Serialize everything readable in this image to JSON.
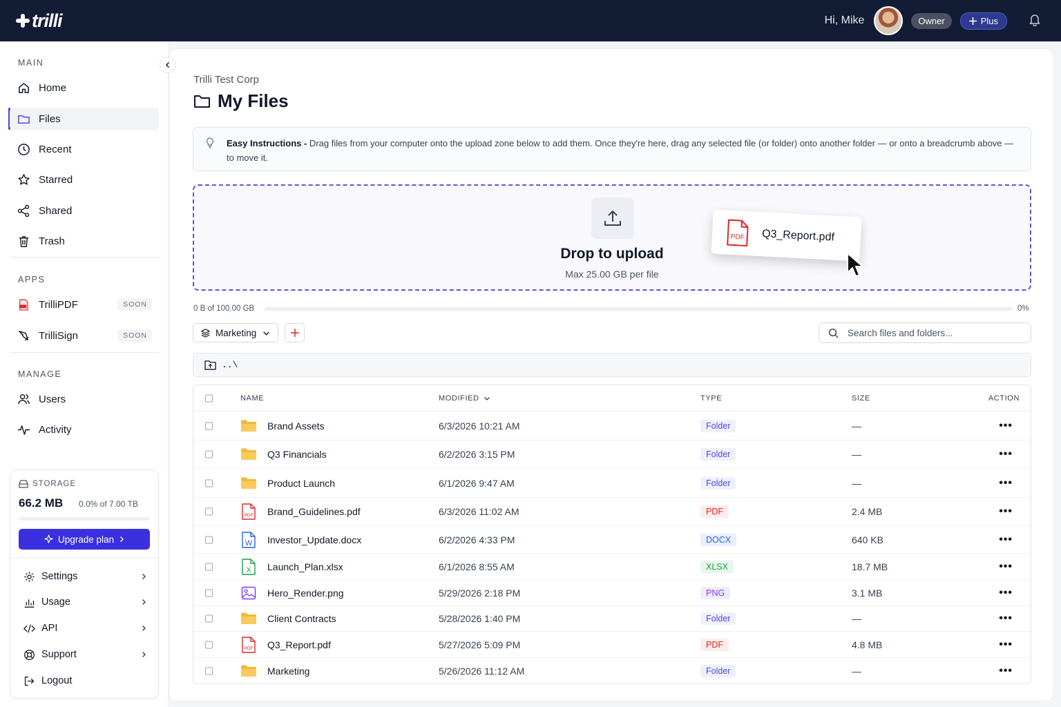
{
  "app": {
    "logo_text": "trilli",
    "greeting": "Hi, Mike",
    "role_badge": "Owner",
    "plan_badge": "Plus"
  },
  "sidebar": {
    "main_label": "MAIN",
    "main_items": [
      {
        "label": "Home",
        "icon": "home-icon"
      },
      {
        "label": "Files",
        "icon": "folder-icon",
        "active": true
      },
      {
        "label": "Recent",
        "icon": "clock-icon"
      },
      {
        "label": "Starred",
        "icon": "star-icon"
      },
      {
        "label": "Shared",
        "icon": "share-icon"
      },
      {
        "label": "Trash",
        "icon": "trash-icon"
      }
    ],
    "apps_label": "APPS",
    "apps_items": [
      {
        "label": "TrilliPDF",
        "badge": "SOON",
        "icon": "pdf-app-icon"
      },
      {
        "label": "TrilliSign",
        "badge": "SOON",
        "icon": "signature-icon"
      }
    ],
    "manage_label": "MANAGE",
    "manage_items": [
      {
        "label": "Users",
        "icon": "users-icon"
      },
      {
        "label": "Activity",
        "icon": "activity-icon"
      }
    ],
    "storage": {
      "label": "STORAGE",
      "used": "66.2 MB",
      "percent_text": "0.0% of 7.00 TB",
      "percent": 0.0,
      "upgrade_label": "Upgrade plan"
    },
    "bottom_items": [
      {
        "label": "Settings",
        "icon": "gear-icon"
      },
      {
        "label": "Usage",
        "icon": "bar-chart-icon"
      },
      {
        "label": "API",
        "icon": "code-icon"
      },
      {
        "label": "Support",
        "icon": "lifebuoy-icon"
      },
      {
        "label": "Logout",
        "icon": "logout-icon"
      }
    ]
  },
  "main": {
    "org_name": "Trilli Test Corp",
    "title": "My Files",
    "instructions_bold": "Easy Instructions -",
    "instructions_text": " Drag files from your computer onto the upload zone below to add them. Once they're here, drag any selected file (or folder) onto another folder — or onto a breadcrumb above — to move it.",
    "dropzone": {
      "title": "Drop to upload",
      "subtitle": "Max 25.00 GB per file",
      "dragging_file": "Q3_Report.pdf"
    },
    "quota": {
      "text": "0 B of 100.00 GB",
      "percent_text": "0%",
      "percent": 0
    },
    "folder_select": "Marketing",
    "search_placeholder": "Search files and folders...",
    "up_dir": "..\\",
    "columns": {
      "name": "NAME",
      "modified": "MODIFIED",
      "type": "TYPE",
      "size": "SIZE",
      "action": "ACTION"
    },
    "rows": [
      {
        "name": "Brand Assets",
        "modified": "6/3/2026 10:21 AM",
        "type": "Folder",
        "size": "—",
        "kind": "folder"
      },
      {
        "name": "Q3 Financials",
        "modified": "6/2/2026 3:15 PM",
        "type": "Folder",
        "size": "—",
        "kind": "folder"
      },
      {
        "name": "Product Launch",
        "modified": "6/1/2026 9:47 AM",
        "type": "Folder",
        "size": "—",
        "kind": "folder"
      },
      {
        "name": "Brand_Guidelines.pdf",
        "modified": "6/3/2026 11:02 AM",
        "type": "PDF",
        "size": "2.4 MB",
        "kind": "pdf"
      },
      {
        "name": "Investor_Update.docx",
        "modified": "6/2/2026 4:33 PM",
        "type": "DOCX",
        "size": "640 KB",
        "kind": "docx"
      },
      {
        "name": "Launch_Plan.xlsx",
        "modified": "6/1/2026 8:55 AM",
        "type": "XLSX",
        "size": "18.7 MB",
        "kind": "xlsx"
      },
      {
        "name": "Hero_Render.png",
        "modified": "5/29/2026 2:18 PM",
        "type": "PNG",
        "size": "3.1 MB",
        "kind": "png"
      },
      {
        "name": "Client Contracts",
        "modified": "5/28/2026 1:40 PM",
        "type": "Folder",
        "size": "—",
        "kind": "folder"
      },
      {
        "name": "Q3_Report.pdf",
        "modified": "5/27/2026 5:09 PM",
        "type": "PDF",
        "size": "4.8 MB",
        "kind": "pdf"
      },
      {
        "name": "Marketing",
        "modified": "5/26/2026 11:12 AM",
        "type": "Folder",
        "size": "—",
        "kind": "folder"
      }
    ],
    "action_glyph": "•••"
  },
  "colors": {
    "topbar": "#131c35",
    "accent": "#4f46e5",
    "folder": "#f6b73c",
    "pdf": "#dc2626",
    "docx": "#2563eb",
    "xlsx": "#16a34a",
    "png": "#7c3aed"
  }
}
